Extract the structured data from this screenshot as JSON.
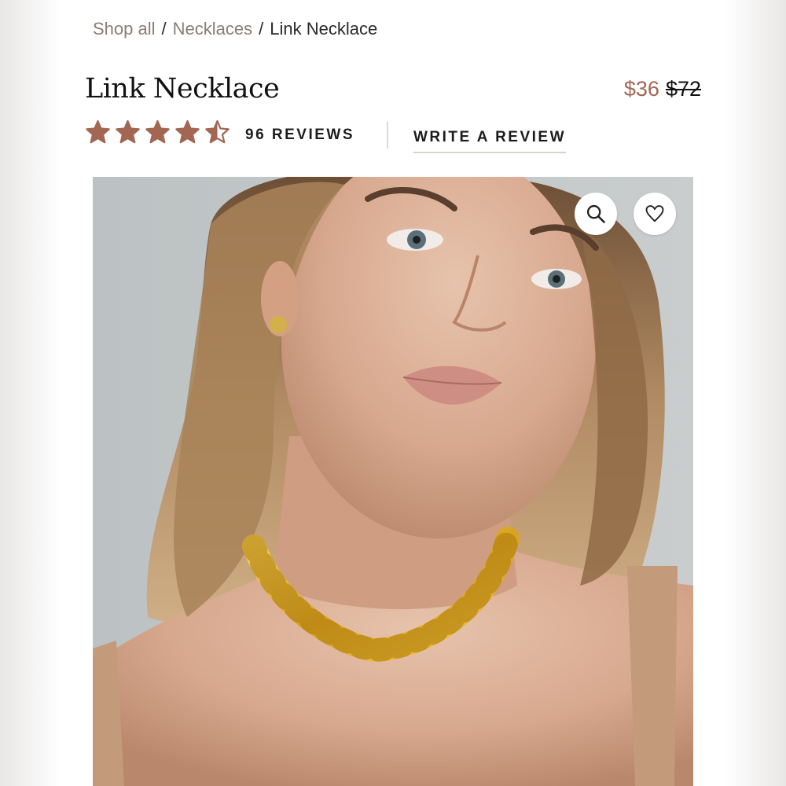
{
  "breadcrumb": {
    "items": [
      "Shop all",
      "Necklaces"
    ],
    "separator": "/",
    "current": "Link Necklace"
  },
  "product": {
    "title": "Link Necklace",
    "sale_price": "$36",
    "original_price": "$72"
  },
  "rating": {
    "value": 4.5,
    "max": 5,
    "star_color": "#a26652",
    "reviews_label": "96 REVIEWS",
    "write_review_label": "WRITE A REVIEW"
  },
  "gallery": {
    "zoom_icon": "search-icon",
    "wishlist_icon": "heart-icon"
  },
  "colors": {
    "accent": "#a26652",
    "breadcrumb_link": "#8a7d72",
    "text": "#111111"
  }
}
